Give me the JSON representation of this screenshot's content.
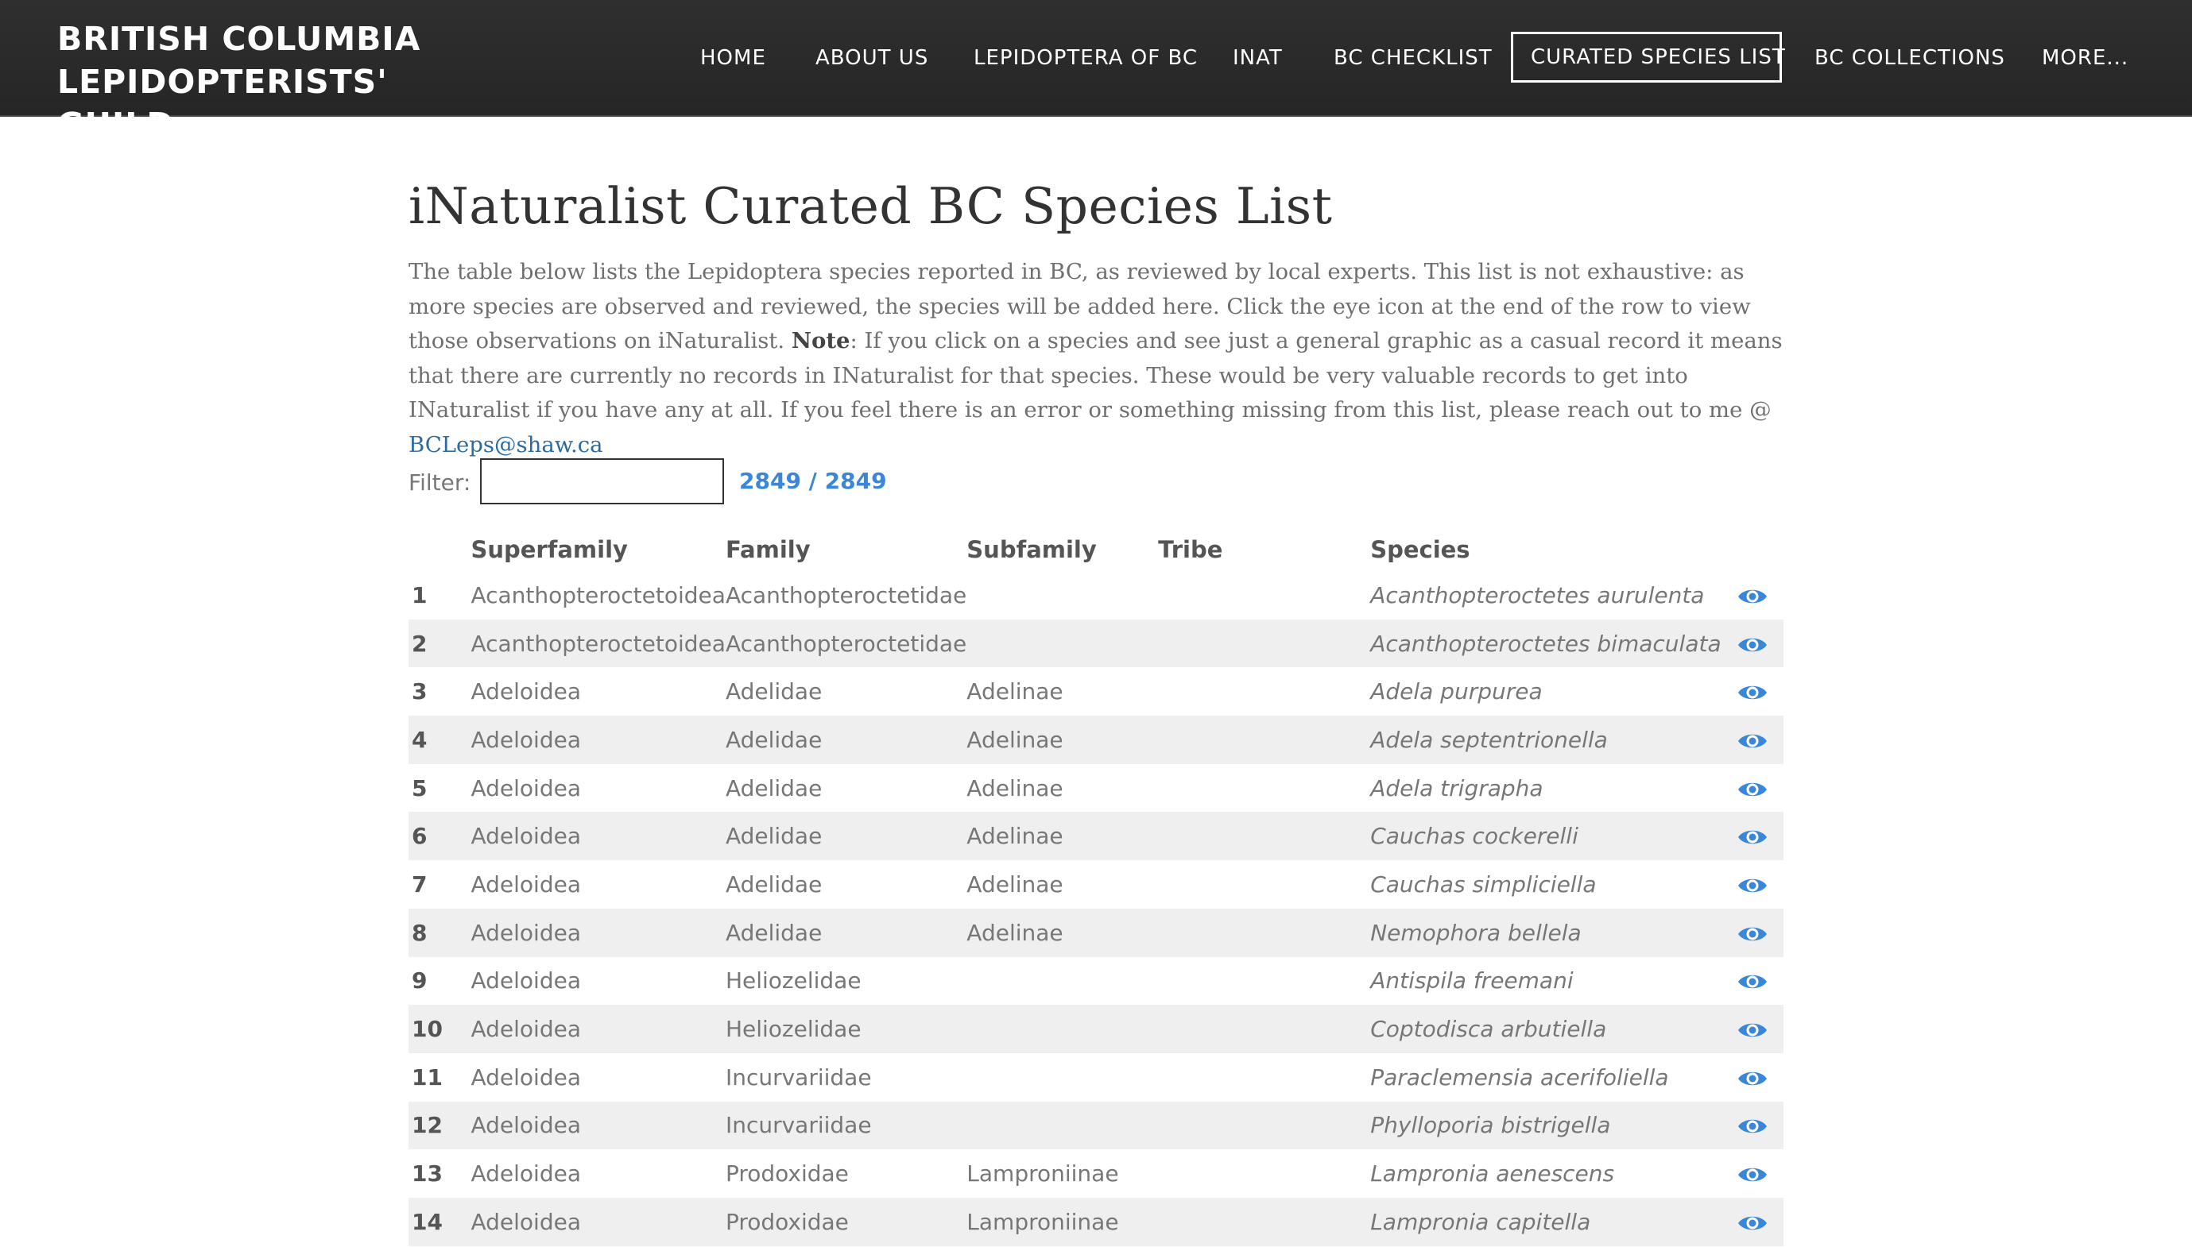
{
  "site": {
    "brand_line1": "BRITISH COLUMBIA LEPIDOPTERISTS'",
    "brand_line2": "GUILD",
    "nav": [
      {
        "label": "HOME"
      },
      {
        "label": "ABOUT US"
      },
      {
        "label": "LEPIDOPTERA OF BC"
      },
      {
        "label": "INAT"
      },
      {
        "label": "BC CHECKLIST"
      },
      {
        "label": "CURATED SPECIES LIST",
        "active": true
      },
      {
        "label": "BC COLLECTIONS"
      },
      {
        "label": "MORE..."
      }
    ]
  },
  "page": {
    "title": "iNaturalist Curated BC Species List",
    "intro_part1": "The table below lists the Lepidoptera species reported in BC, as reviewed by local experts. This list is not exhaustive: as more species are observed and reviewed, the species will be added here.  Click the eye icon at the end of the row to view those observations on iNaturalist.  ",
    "intro_note_label": "Note",
    "intro_part2": ": If you click on a species and see just a general graphic as a casual record it means that there are currently no records in INaturalist for that species.  These would be very valuable records to get into INaturalist if you have any at all. If you feel there is an error or something missing from this list, please reach out to me @ ",
    "intro_email": "BCLeps@shaw.ca"
  },
  "filter": {
    "label": "Filter:",
    "value": "",
    "count": "2849 / 2849"
  },
  "table": {
    "headers": {
      "num": "",
      "superfamily": "Superfamily",
      "family": "Family",
      "subfamily": "Subfamily",
      "tribe": "Tribe",
      "species": "Species"
    },
    "rows": [
      {
        "num": "1",
        "superfamily": "Acanthopteroctetoidea",
        "family": "Acanthopteroctetidae",
        "subfamily": "",
        "tribe": "",
        "species": "Acanthopteroctetes aurulenta"
      },
      {
        "num": "2",
        "superfamily": "Acanthopteroctetoidea",
        "family": "Acanthopteroctetidae",
        "subfamily": "",
        "tribe": "",
        "species": "Acanthopteroctetes bimaculata"
      },
      {
        "num": "3",
        "superfamily": "Adeloidea",
        "family": "Adelidae",
        "subfamily": "Adelinae",
        "tribe": "",
        "species": "Adela purpurea"
      },
      {
        "num": "4",
        "superfamily": "Adeloidea",
        "family": "Adelidae",
        "subfamily": "Adelinae",
        "tribe": "",
        "species": "Adela septentrionella"
      },
      {
        "num": "5",
        "superfamily": "Adeloidea",
        "family": "Adelidae",
        "subfamily": "Adelinae",
        "tribe": "",
        "species": "Adela trigrapha"
      },
      {
        "num": "6",
        "superfamily": "Adeloidea",
        "family": "Adelidae",
        "subfamily": "Adelinae",
        "tribe": "",
        "species": "Cauchas cockerelli"
      },
      {
        "num": "7",
        "superfamily": "Adeloidea",
        "family": "Adelidae",
        "subfamily": "Adelinae",
        "tribe": "",
        "species": "Cauchas simpliciella"
      },
      {
        "num": "8",
        "superfamily": "Adeloidea",
        "family": "Adelidae",
        "subfamily": "Adelinae",
        "tribe": "",
        "species": "Nemophora bellela"
      },
      {
        "num": "9",
        "superfamily": "Adeloidea",
        "family": "Heliozelidae",
        "subfamily": "",
        "tribe": "",
        "species": "Antispila freemani"
      },
      {
        "num": "10",
        "superfamily": "Adeloidea",
        "family": "Heliozelidae",
        "subfamily": "",
        "tribe": "",
        "species": "Coptodisca arbutiella"
      },
      {
        "num": "11",
        "superfamily": "Adeloidea",
        "family": "Incurvariidae",
        "subfamily": "",
        "tribe": "",
        "species": "Paraclemensia acerifoliella"
      },
      {
        "num": "12",
        "superfamily": "Adeloidea",
        "family": "Incurvariidae",
        "subfamily": "",
        "tribe": "",
        "species": "Phylloporia bistrigella"
      },
      {
        "num": "13",
        "superfamily": "Adeloidea",
        "family": "Prodoxidae",
        "subfamily": "Lamproniinae",
        "tribe": "",
        "species": "Lampronia aenescens"
      },
      {
        "num": "14",
        "superfamily": "Adeloidea",
        "family": "Prodoxidae",
        "subfamily": "Lamproniinae",
        "tribe": "",
        "species": "Lampronia capitella"
      }
    ]
  },
  "colors": {
    "header_bg": "#2b2b2b",
    "accent_blue": "#3a87d9",
    "link_blue": "#2c6aa0",
    "row_stripe": "#efefef"
  },
  "icons": {
    "row_action": "eye-icon"
  }
}
